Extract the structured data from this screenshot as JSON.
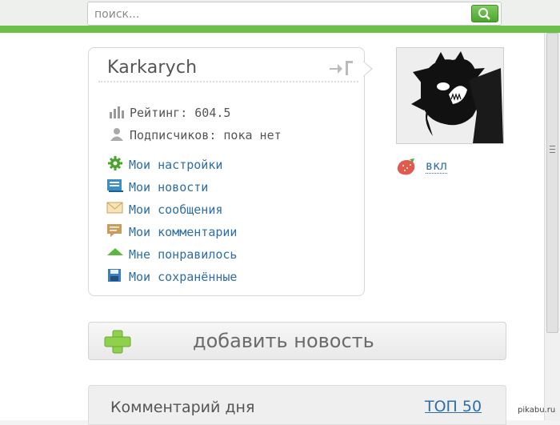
{
  "search": {
    "placeholder": "поиск..."
  },
  "profile": {
    "username": "Karkarych",
    "rating_label": "Рейтинг: 604.5",
    "subscribers_label": "Подписчиков: пока нет"
  },
  "menu": [
    {
      "label": "Мои настройки",
      "icon": "gear-icon"
    },
    {
      "label": "Мои новости",
      "icon": "news-icon"
    },
    {
      "label": "Мои сообщения",
      "icon": "envelope-icon"
    },
    {
      "label": "Мои комментарии",
      "icon": "comment-icon"
    },
    {
      "label": "Мне понравилось",
      "icon": "upvote-icon"
    },
    {
      "label": "Мои сохранённые",
      "icon": "save-icon"
    }
  ],
  "strawberry_toggle": {
    "label": "вкл"
  },
  "add_news": {
    "label": "добавить новость"
  },
  "comment_of_day": {
    "title": "Комментарий дня",
    "top_link": "ТОП 50"
  },
  "watermark": "pikabu.ru",
  "colors": {
    "accent_green": "#6cc04a",
    "link_blue": "#2d6fa6"
  }
}
